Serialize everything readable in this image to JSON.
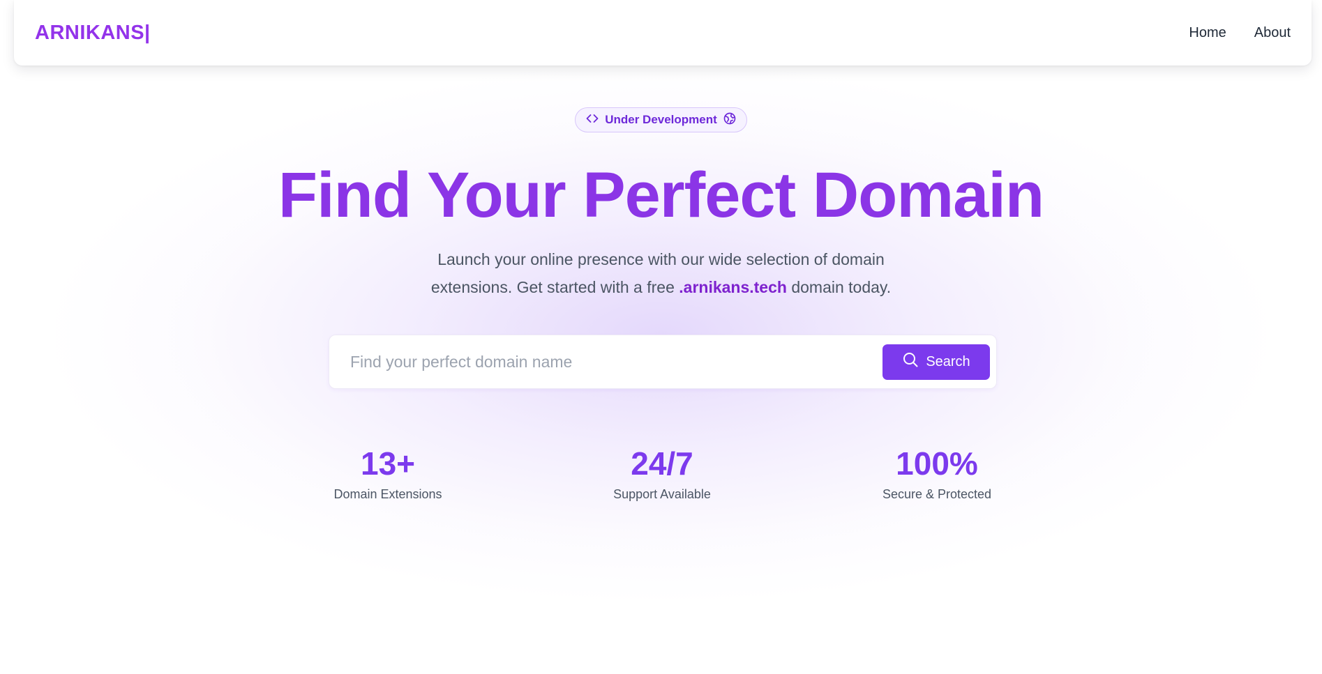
{
  "navbar": {
    "logo": "ARNIKANS|",
    "links": [
      "Home",
      "About"
    ]
  },
  "hero": {
    "badge": {
      "label": "Under Development",
      "left_icon": "code-icon",
      "right_icon": "globe-icon"
    },
    "title": "Find Your Perfect Domain",
    "subtitle": {
      "line1": "Launch your online presence with our wide selection of domain",
      "line2_prefix": "extensions. Get started with a free ",
      "highlight": ".arnikans.tech",
      "line2_suffix": " domain today."
    }
  },
  "search": {
    "placeholder": "Find your perfect domain name",
    "value": "",
    "button_label": "Search",
    "button_icon": "search-icon"
  },
  "stats": [
    {
      "value": "13+",
      "label": "Domain Extensions"
    },
    {
      "value": "24/7",
      "label": "Support Available"
    },
    {
      "value": "100%",
      "label": "Secure & Protected"
    }
  ],
  "colors": {
    "brand": "#9333ea",
    "accent": "#7c3aed",
    "title": "#8b35e6",
    "text": "#4b5563"
  }
}
